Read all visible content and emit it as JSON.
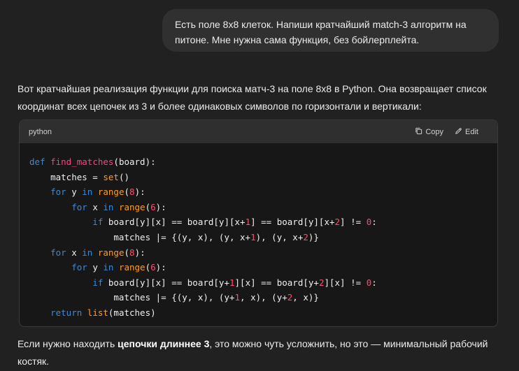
{
  "user_message": "Есть поле 8x8 клеток. Напиши кратчайший match-3 алгоритм на питоне. Мне нужна сама функция, без бойлерплейта.",
  "assistant_intro": "Вот кратчайшая реализация функции для поиска матч-3 на поле 8x8 в Python. Она возвращает список координат всех цепочек из 3 и более одинаковых символов по горизонтали и вертикали:",
  "code_block": {
    "language": "python",
    "copy_label": "Copy",
    "edit_label": "Edit",
    "copy_icon": "copy-icon",
    "edit_icon": "pencil-icon",
    "lines": [
      [
        [
          "kw",
          "def "
        ],
        [
          "fn",
          "find_matches"
        ],
        [
          "txt",
          "(board):"
        ]
      ],
      [
        [
          "txt",
          "    matches = "
        ],
        [
          "bi",
          "set"
        ],
        [
          "txt",
          "()"
        ]
      ],
      [
        [
          "kw",
          "    for "
        ],
        [
          "txt",
          "y "
        ],
        [
          "kw",
          "in "
        ],
        [
          "bi",
          "range"
        ],
        [
          "txt",
          "("
        ],
        [
          "num",
          "8"
        ],
        [
          "txt",
          "):"
        ]
      ],
      [
        [
          "kw",
          "        for "
        ],
        [
          "txt",
          "x "
        ],
        [
          "kw",
          "in "
        ],
        [
          "bi",
          "range"
        ],
        [
          "txt",
          "("
        ],
        [
          "num",
          "6"
        ],
        [
          "txt",
          "):"
        ]
      ],
      [
        [
          "kw",
          "            if "
        ],
        [
          "txt",
          "board[y][x] == board[y][x+"
        ],
        [
          "num",
          "1"
        ],
        [
          "txt",
          "] == board[y][x+"
        ],
        [
          "num",
          "2"
        ],
        [
          "txt",
          "] != "
        ],
        [
          "num",
          "0"
        ],
        [
          "txt",
          ":"
        ]
      ],
      [
        [
          "txt",
          "                matches |= {(y, x), (y, x+"
        ],
        [
          "num",
          "1"
        ],
        [
          "txt",
          "), (y, x+"
        ],
        [
          "num",
          "2"
        ],
        [
          "txt",
          ")}"
        ]
      ],
      [
        [
          "kw",
          "    for "
        ],
        [
          "txt",
          "x "
        ],
        [
          "kw",
          "in "
        ],
        [
          "bi",
          "range"
        ],
        [
          "txt",
          "("
        ],
        [
          "num",
          "8"
        ],
        [
          "txt",
          "):"
        ]
      ],
      [
        [
          "kw",
          "        for "
        ],
        [
          "txt",
          "y "
        ],
        [
          "kw",
          "in "
        ],
        [
          "bi",
          "range"
        ],
        [
          "txt",
          "("
        ],
        [
          "num",
          "6"
        ],
        [
          "txt",
          "):"
        ]
      ],
      [
        [
          "kw",
          "            if "
        ],
        [
          "txt",
          "board[y][x] == board[y+"
        ],
        [
          "num",
          "1"
        ],
        [
          "txt",
          "][x] == board[y+"
        ],
        [
          "num",
          "2"
        ],
        [
          "txt",
          "][x] != "
        ],
        [
          "num",
          "0"
        ],
        [
          "txt",
          ":"
        ]
      ],
      [
        [
          "txt",
          "                matches |= {(y, x), (y+"
        ],
        [
          "num",
          "1"
        ],
        [
          "txt",
          ", x), (y+"
        ],
        [
          "num",
          "2"
        ],
        [
          "txt",
          ", x)}"
        ]
      ],
      [
        [
          "kw",
          "    return "
        ],
        [
          "bi",
          "list"
        ],
        [
          "txt",
          "(matches)"
        ]
      ]
    ]
  },
  "assistant_outro": {
    "before": "Если нужно находить ",
    "bold": "цепочки длиннее 3",
    "after": ", это можно чуть усложнить, но это — минимальный рабочий костяк."
  },
  "colors": {
    "background": "#212121",
    "bubble": "#303030",
    "code_background": "#171717",
    "code_header": "#2f2f2f",
    "keyword": "#3a8ad8",
    "function_name": "#ff4080",
    "builtin": "#ff9a2e",
    "number": "#ff4d6d"
  }
}
